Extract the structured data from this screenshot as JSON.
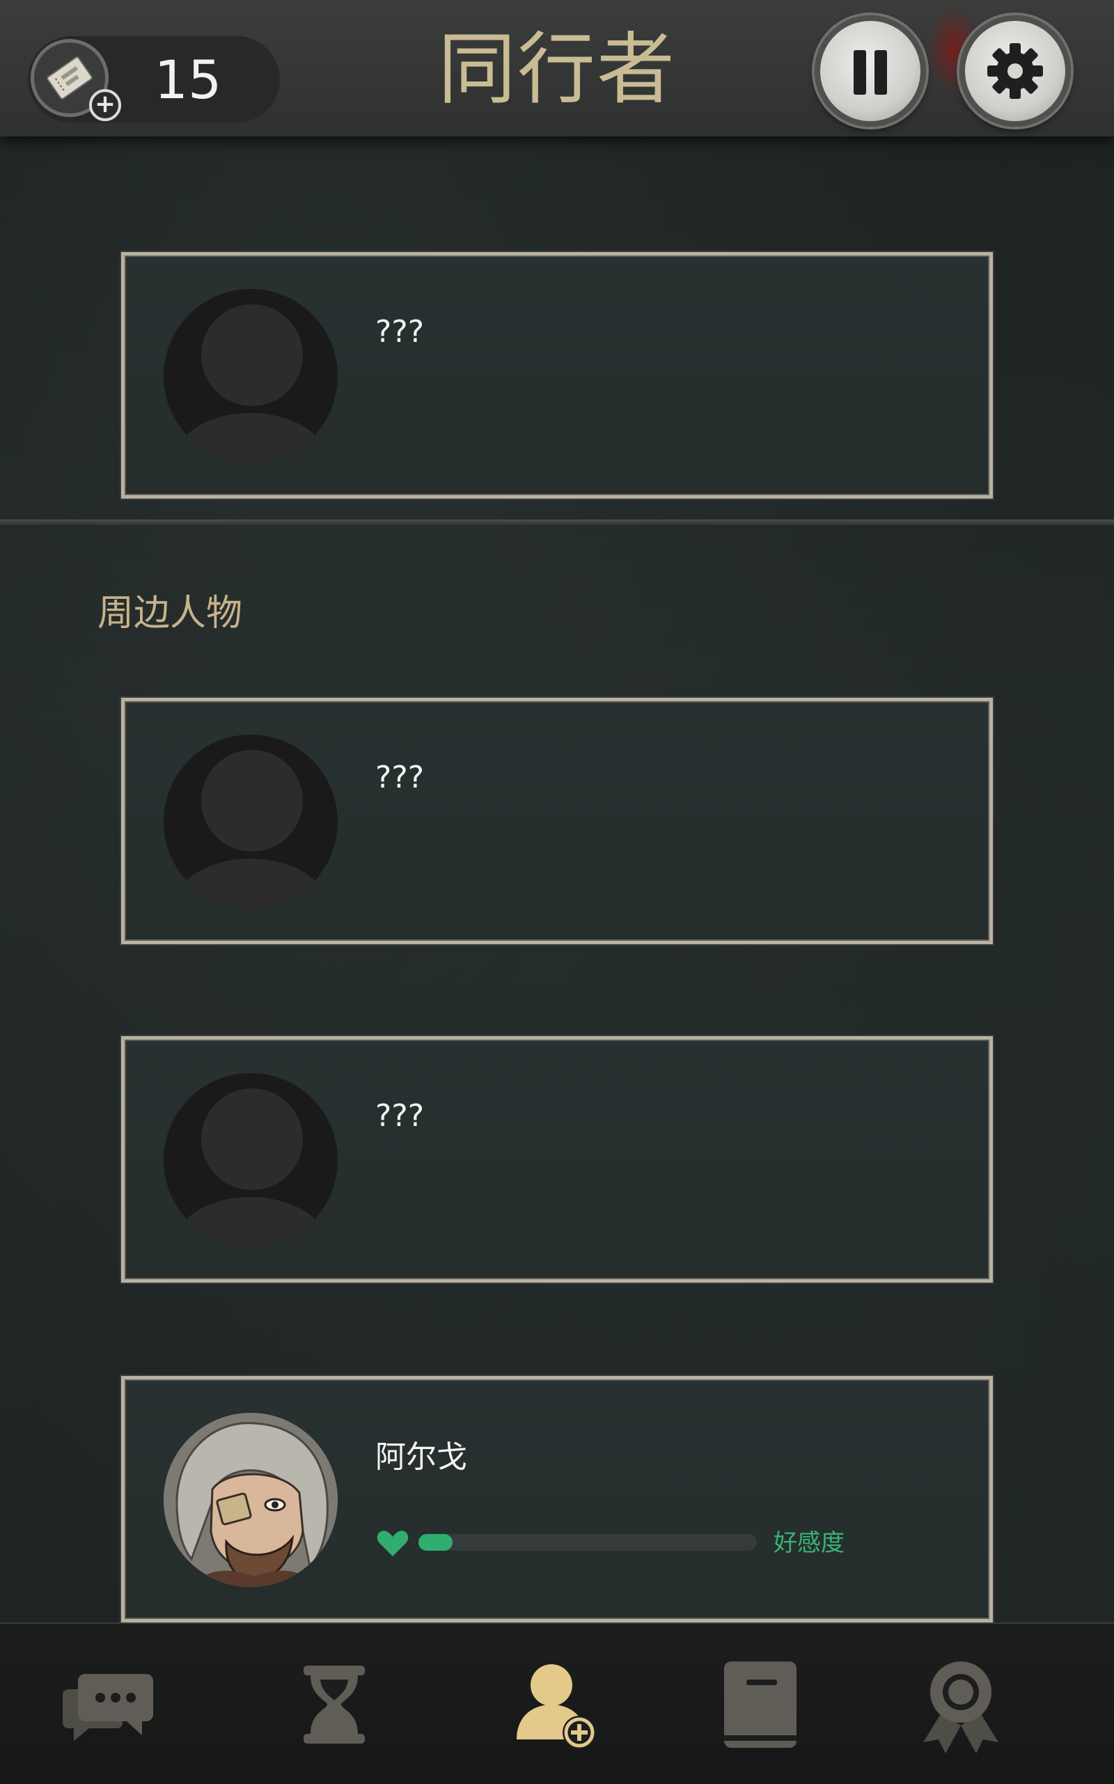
{
  "header": {
    "ticket_count": "15",
    "title": "同行者"
  },
  "companions": [
    {
      "name": "???"
    }
  ],
  "nearby": {
    "section_label": "周边人物",
    "characters": [
      {
        "name": "???"
      },
      {
        "name": "???"
      },
      {
        "name": "阿尔戈",
        "affinity_label": "好感度",
        "affinity_fraction": 0.1
      }
    ]
  },
  "colors": {
    "title_gold": "#c9bc95",
    "section_gold": "#c7b38a",
    "affinity_green": "#2fae6f",
    "nav_active": "#e3c98a",
    "nav_inactive": "#5b5a53"
  },
  "icons": {
    "ticket": "ticket-add-icon",
    "pause": "pause-icon",
    "settings": "gear-icon",
    "nav": [
      "chat-icon",
      "hourglass-icon",
      "companion-add-icon",
      "book-icon",
      "achievement-ribbon-icon"
    ],
    "affinity": "heart-icon"
  },
  "bottom_nav": {
    "active_index": 2
  }
}
